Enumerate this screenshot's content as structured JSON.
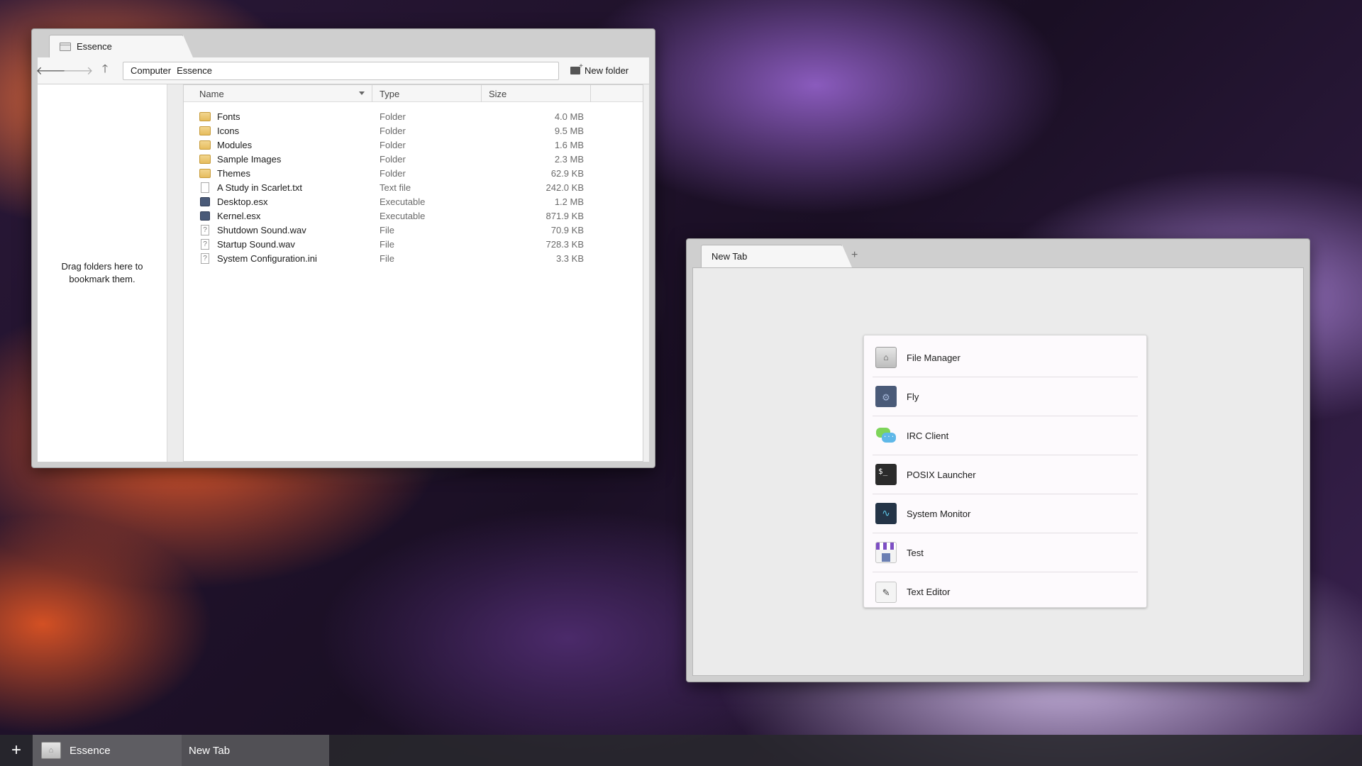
{
  "file_manager": {
    "tab_title": "Essence",
    "toolbar": {
      "back_glyph": "🡐",
      "forward_glyph": "🡒",
      "up_glyph": "🡑",
      "path": [
        "Computer",
        "Essence"
      ],
      "new_folder_label": "New folder"
    },
    "sidebar_hint": "Drag folders here to bookmark them.",
    "columns": {
      "name": "Name",
      "type": "Type",
      "size": "Size"
    },
    "files": [
      {
        "name": "Fonts",
        "type": "Folder",
        "size": "4.0 MB",
        "icon": "folder-icon"
      },
      {
        "name": "Icons",
        "type": "Folder",
        "size": "9.5 MB",
        "icon": "folder-icon"
      },
      {
        "name": "Modules",
        "type": "Folder",
        "size": "1.6 MB",
        "icon": "folder-icon"
      },
      {
        "name": "Sample Images",
        "type": "Folder",
        "size": "2.3 MB",
        "icon": "folder-icon"
      },
      {
        "name": "Themes",
        "type": "Folder",
        "size": "62.9 KB",
        "icon": "folder-icon"
      },
      {
        "name": "A Study in Scarlet.txt",
        "type": "Text file",
        "size": "242.0 KB",
        "icon": "text-file-icon"
      },
      {
        "name": "Desktop.esx",
        "type": "Executable",
        "size": "1.2 MB",
        "icon": "executable-icon"
      },
      {
        "name": "Kernel.esx",
        "type": "Executable",
        "size": "871.9 KB",
        "icon": "executable-icon"
      },
      {
        "name": "Shutdown Sound.wav",
        "type": "File",
        "size": "70.9 KB",
        "icon": "unknown-file-icon"
      },
      {
        "name": "Startup Sound.wav",
        "type": "File",
        "size": "728.3 KB",
        "icon": "unknown-file-icon"
      },
      {
        "name": "System Configuration.ini",
        "type": "File",
        "size": "3.3 KB",
        "icon": "unknown-file-icon"
      }
    ]
  },
  "browser": {
    "tab_title": "New Tab",
    "new_tab_glyph": "+",
    "apps": [
      {
        "label": "File Manager",
        "icon": "file-manager-icon"
      },
      {
        "label": "Fly",
        "icon": "fly-icon"
      },
      {
        "label": "IRC Client",
        "icon": "irc-client-icon"
      },
      {
        "label": "POSIX Launcher",
        "icon": "posix-launcher-icon"
      },
      {
        "label": "System Monitor",
        "icon": "system-monitor-icon"
      },
      {
        "label": "Test",
        "icon": "test-icon"
      },
      {
        "label": "Text Editor",
        "icon": "text-editor-icon"
      }
    ]
  },
  "taskbar": {
    "add_glyph": "+",
    "items": [
      {
        "label": "Essence"
      },
      {
        "label": "New Tab"
      }
    ]
  },
  "colors": {
    "window_frame": "#cfcfcf",
    "taskbar": "#28282c",
    "launcher_bg": "#fdfafd"
  }
}
